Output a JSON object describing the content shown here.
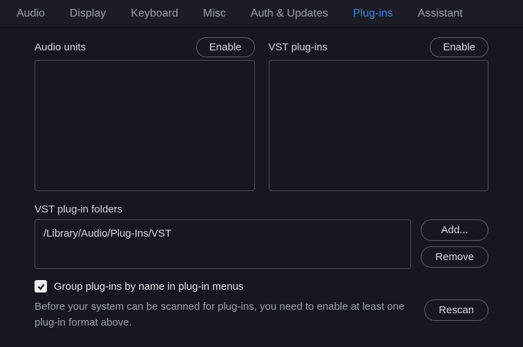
{
  "tabs": {
    "audio": "Audio",
    "display": "Display",
    "keyboard": "Keyboard",
    "misc": "Misc",
    "auth": "Auth & Updates",
    "plugins": "Plug-ins",
    "assistant": "Assistant"
  },
  "sections": {
    "audio_units_label": "Audio units",
    "vst_plugins_label": "VST plug-ins",
    "enable_button": "Enable"
  },
  "folders": {
    "label": "VST plug-in folders",
    "items": [
      "/Library/Audio/Plug-Ins/VST"
    ],
    "add_button": "Add...",
    "remove_button": "Remove"
  },
  "group_checkbox": {
    "checked": true,
    "label": "Group plug-ins by name in plug-in menus"
  },
  "hint": "Before your system can be scanned for plug-ins, you need to enable at least one plug-in format above.",
  "rescan_button": "Rescan"
}
